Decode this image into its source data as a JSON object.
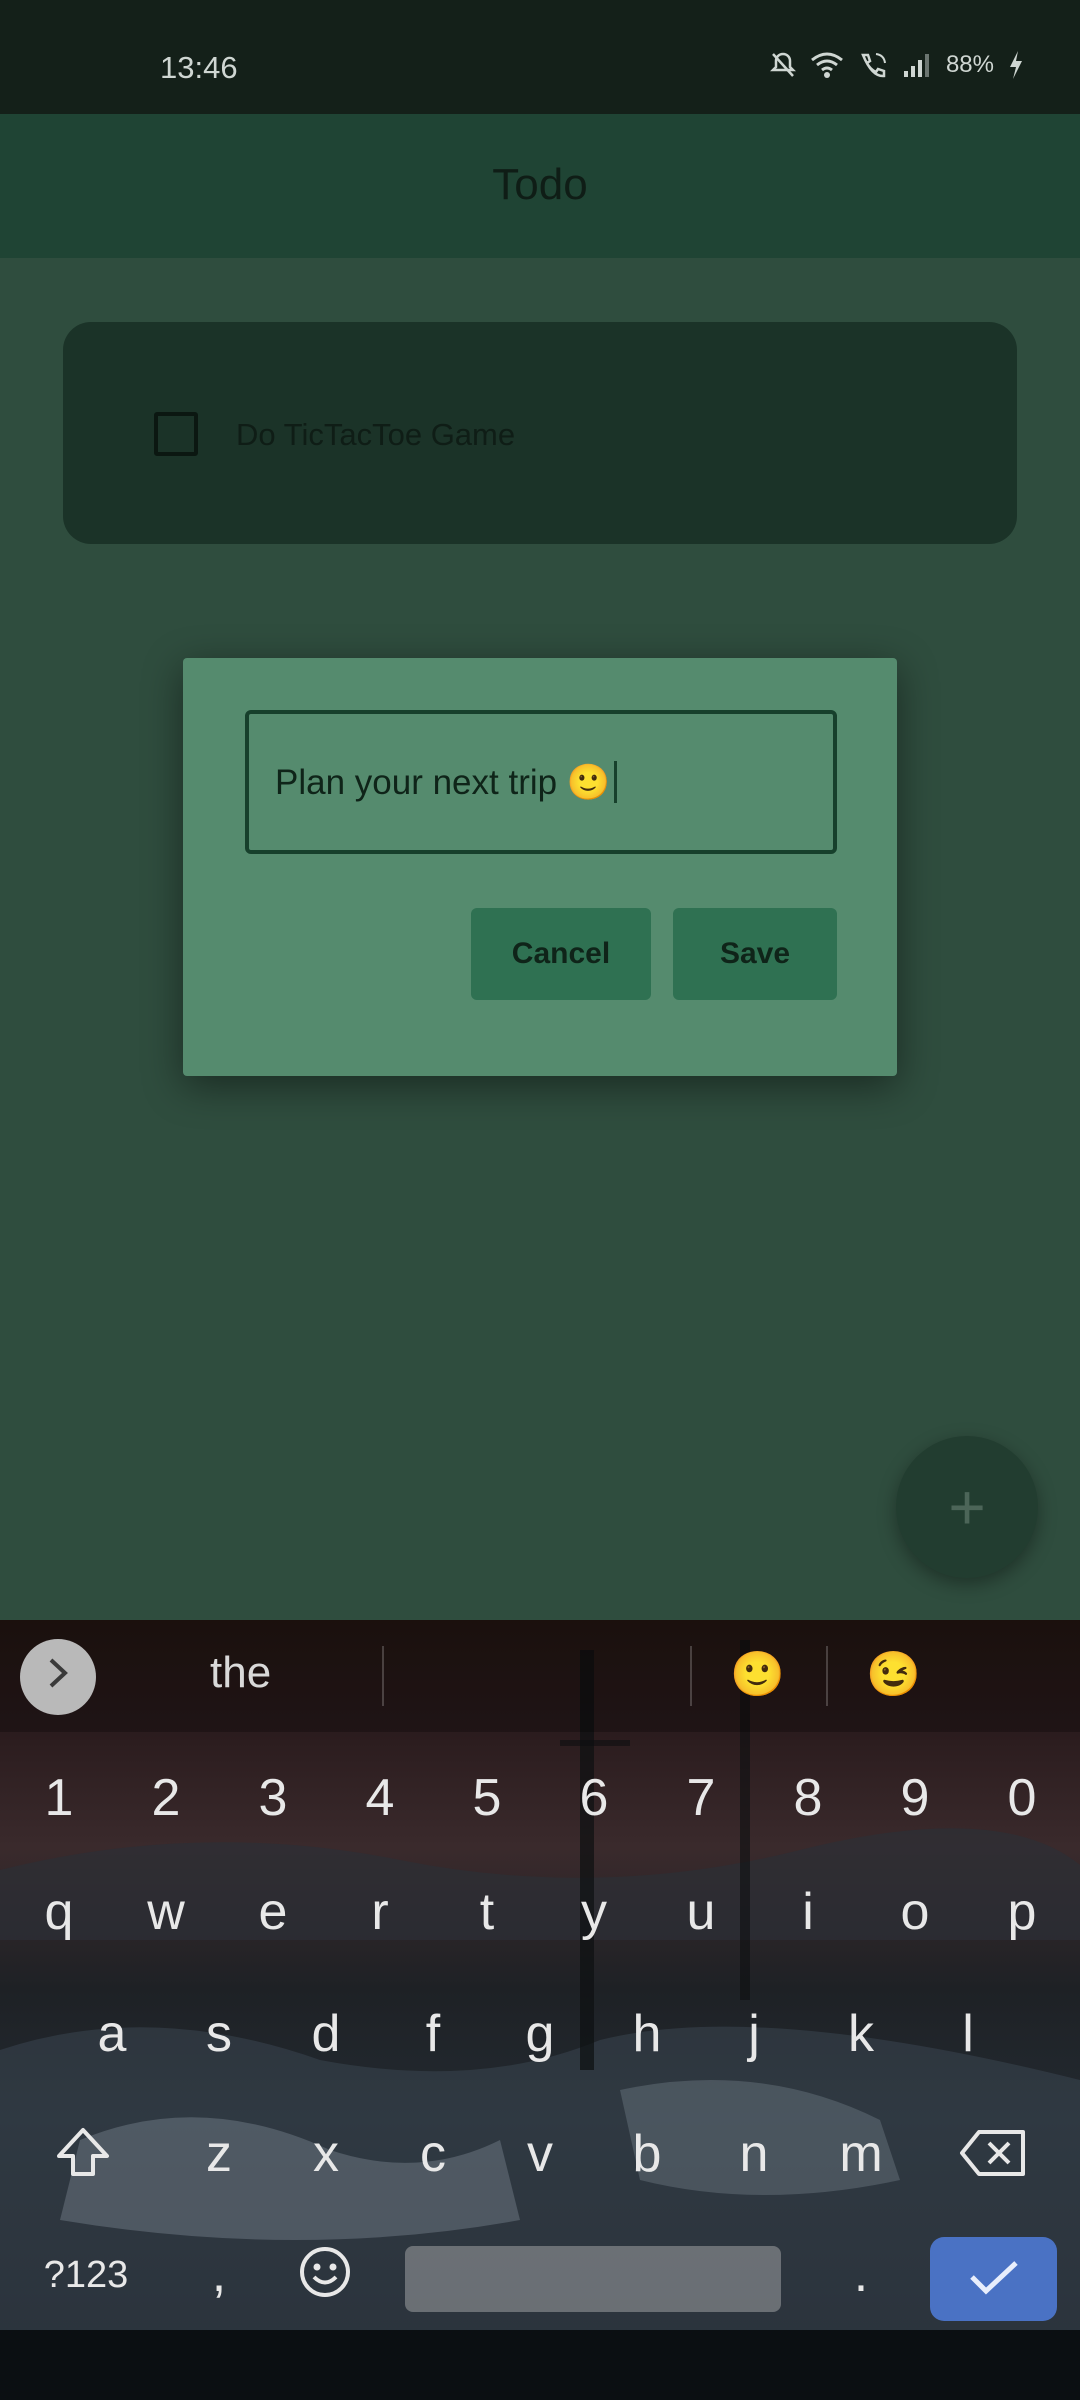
{
  "status_bar": {
    "time": "13:46",
    "battery": "88%",
    "icons": [
      "mute-icon",
      "wifi-icon",
      "call-icon",
      "signal-icon",
      "battery-charging-icon"
    ]
  },
  "app_bar": {
    "title": "Todo"
  },
  "todos": [
    {
      "label": "Do TicTacToe Game",
      "checked": false
    }
  ],
  "dialog": {
    "input_value": "Plan your next trip 🙂",
    "cancel_label": "Cancel",
    "save_label": "Save"
  },
  "fab": {
    "icon": "plus-icon",
    "label": "+"
  },
  "keyboard": {
    "suggestions": [
      "the",
      "",
      "🙂",
      "😉"
    ],
    "number_row": [
      "1",
      "2",
      "3",
      "4",
      "5",
      "6",
      "7",
      "8",
      "9",
      "0"
    ],
    "row1": [
      "q",
      "w",
      "e",
      "r",
      "t",
      "y",
      "u",
      "i",
      "o",
      "p"
    ],
    "row2": [
      "a",
      "s",
      "d",
      "f",
      "g",
      "h",
      "j",
      "k",
      "l"
    ],
    "row3": [
      "z",
      "x",
      "c",
      "v",
      "b",
      "n",
      "m"
    ],
    "symbols_label": "?123",
    "comma": ",",
    "period": ".",
    "enter_color": "#4a72c4"
  },
  "colors": {
    "app_bar": "#1f4434",
    "dialog": "#558b6e",
    "button": "#2f7152"
  }
}
